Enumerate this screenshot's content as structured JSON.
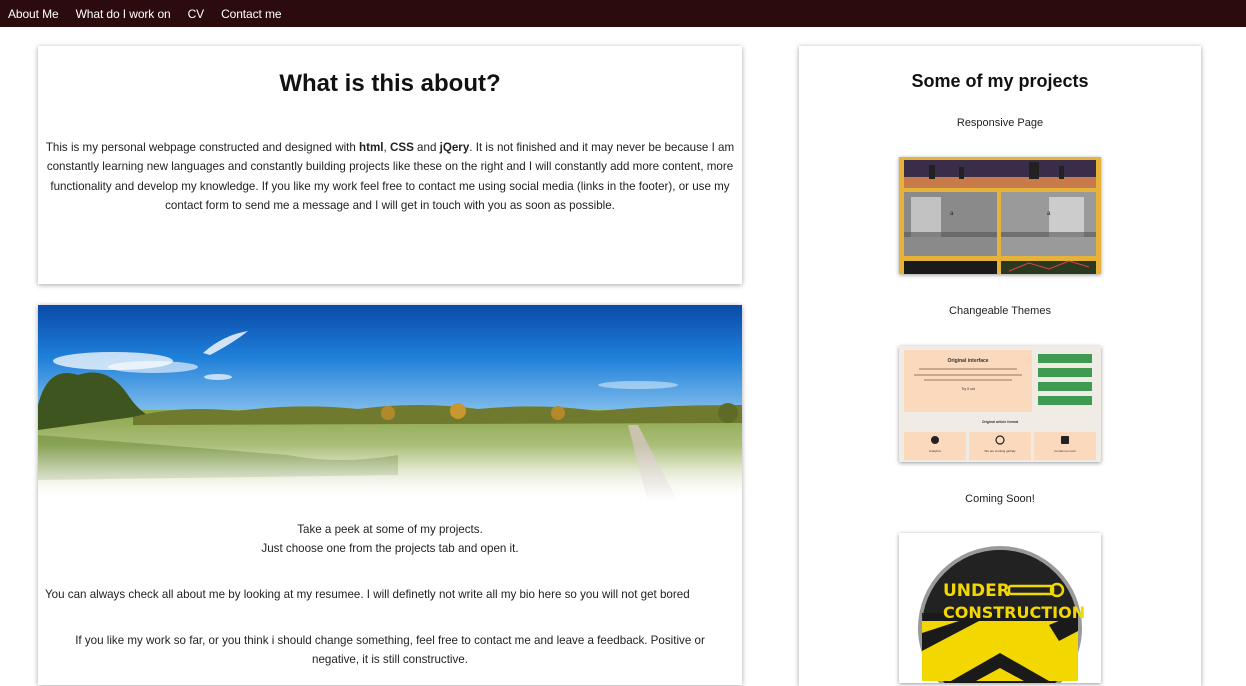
{
  "nav": {
    "items": [
      {
        "label": "About Me"
      },
      {
        "label": "What do I work on"
      },
      {
        "label": "CV"
      },
      {
        "label": "Contact me"
      }
    ]
  },
  "about": {
    "title": "What is this about?",
    "text_parts": [
      "This is my personal webpage constructed and designed with ",
      "html",
      ", ",
      "CSS",
      " and ",
      "jQery",
      ". It is not finished and it may never be because I am constantly learning new languages and constantly building projects like these on the right and I will constantly add more content, more functionality and develop my knowledge. If you like my work feel free to contact me using social media (links in the footer), or use my contact form to send me a message and I will get in touch with you as soon as possible."
    ]
  },
  "intro": {
    "peek_line1": "Take a peek at some of my projects.",
    "peek_line2": "Just choose one from the projects tab and open it.",
    "resume_text": "You can always check all about me by looking at my resumee. I will definetly not write all my bio here so you will not get bored",
    "feedback_line1": "If you like my work so far, or you think i should change something, feel free to contact me and leave a feedback. Positive or",
    "feedback_line2": "negative, it is still constructive."
  },
  "projects": {
    "title": "Some of my projects",
    "items": [
      {
        "label": "Responsive Page"
      },
      {
        "label": "Changeable Themes"
      },
      {
        "label": "Coming Soon!"
      }
    ],
    "theme_thumb": {
      "heading": "Original interface",
      "button_label": "Try it out",
      "section_title": "Original article format",
      "col_labels": [
        "Analytics",
        "We are working globaly",
        "Contact us now!"
      ]
    },
    "construction_text": [
      "UNDER",
      "CONSTRUCTION"
    ]
  },
  "colors": {
    "nav_bg": "#2b0b0e",
    "thumb_gold": "#e6b23a",
    "theme_peach": "#fbd9bd",
    "theme_green": "#3f9a52",
    "construction_yellow": "#f2d800"
  }
}
